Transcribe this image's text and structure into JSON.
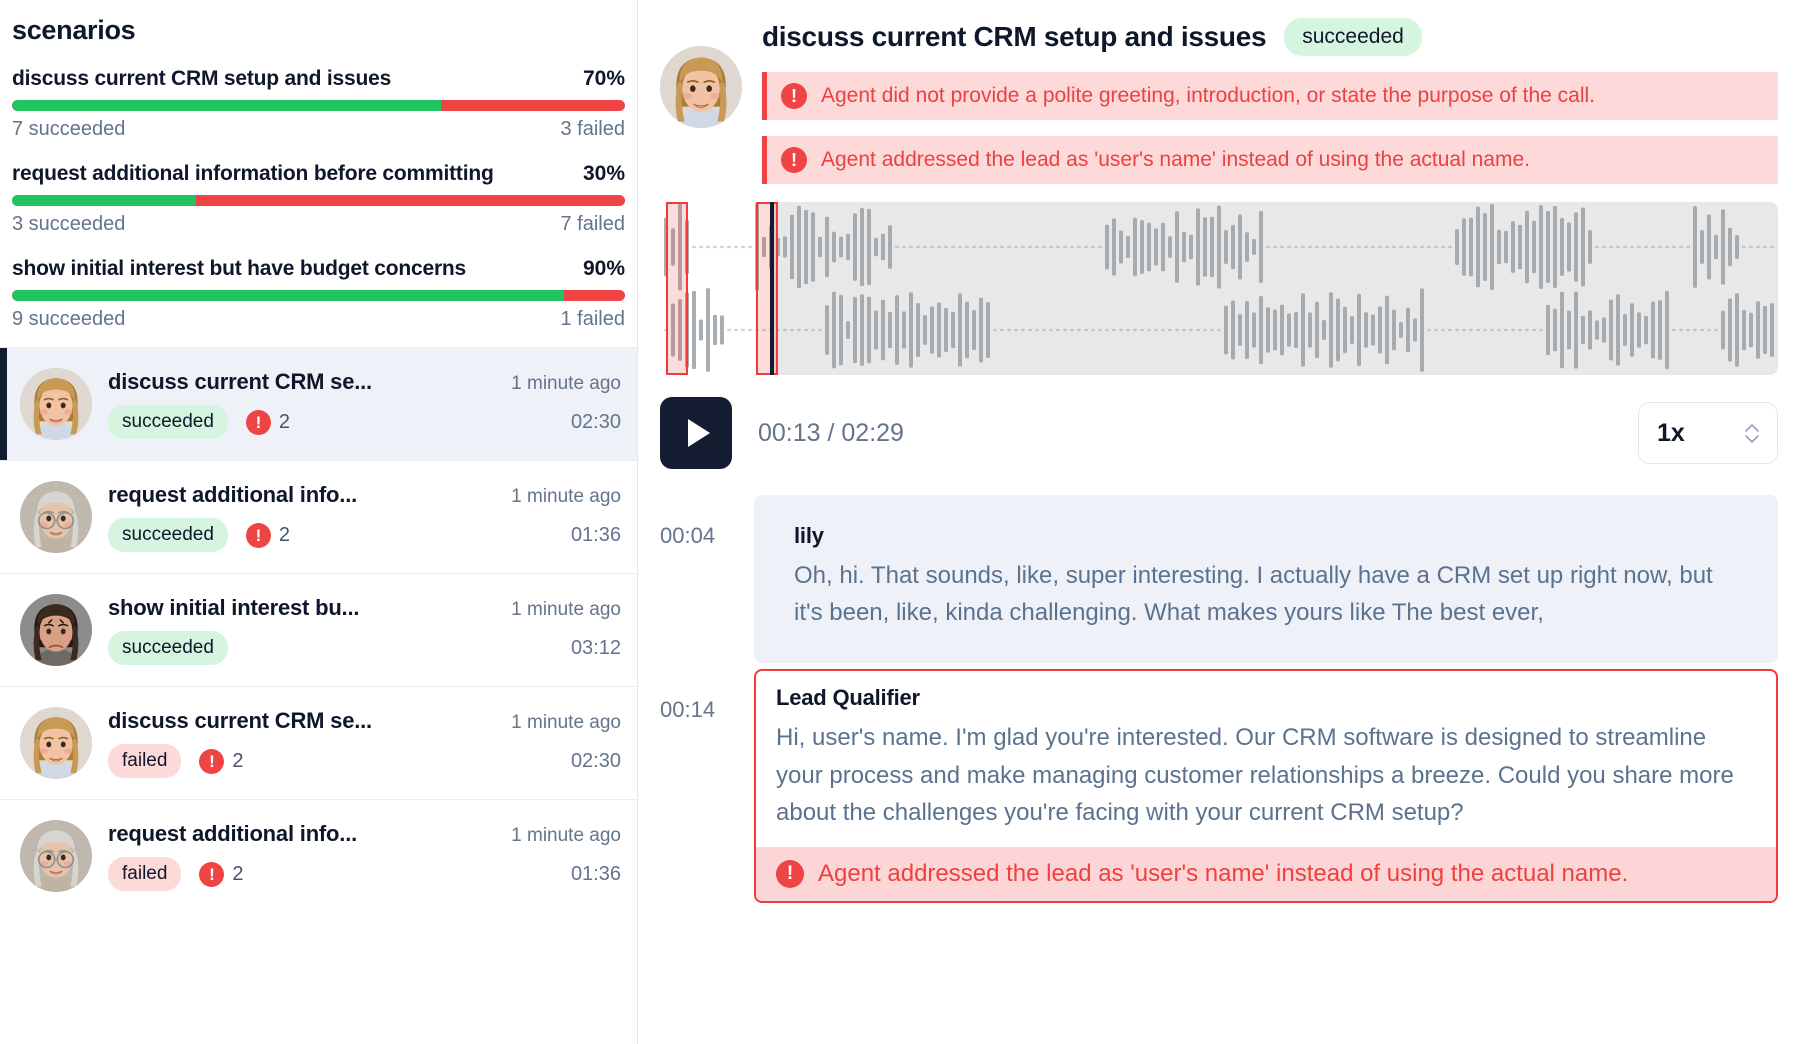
{
  "sidebar": {
    "title": "scenarios",
    "scenarios": [
      {
        "name": "discuss current CRM setup and issues",
        "percent": "70%",
        "fill": 70,
        "succeeded": "7 succeeded",
        "failed": "3 failed"
      },
      {
        "name": "request additional information before committing",
        "percent": "30%",
        "fill": 30,
        "succeeded": "3 succeeded",
        "failed": "7 failed"
      },
      {
        "name": "show initial interest but have budget concerns",
        "percent": "90%",
        "fill": 90,
        "succeeded": "9 succeeded",
        "failed": "1 failed"
      }
    ],
    "runs": [
      {
        "name": "discuss current CRM se...",
        "time": "1 minute ago",
        "status": "succeeded",
        "issues": "2",
        "duration": "02:30",
        "avatar": "woman-blonde",
        "selected": true
      },
      {
        "name": "request additional info...",
        "time": "1 minute ago",
        "status": "succeeded",
        "issues": "2",
        "duration": "01:36",
        "avatar": "woman-elder",
        "selected": false
      },
      {
        "name": "show initial interest bu...",
        "time": "1 minute ago",
        "status": "succeeded",
        "issues": "",
        "duration": "03:12",
        "avatar": "man-dark",
        "selected": false
      },
      {
        "name": "discuss current CRM se...",
        "time": "1 minute ago",
        "status": "failed",
        "issues": "2",
        "duration": "02:30",
        "avatar": "woman-blonde",
        "selected": false
      },
      {
        "name": "request additional info...",
        "time": "1 minute ago",
        "status": "failed",
        "issues": "2",
        "duration": "01:36",
        "avatar": "woman-elder",
        "selected": false
      }
    ]
  },
  "detail": {
    "avatar": "woman-blonde",
    "title": "discuss current CRM setup and issues",
    "status_badge": "succeeded",
    "alerts": [
      "Agent did not provide a polite greeting, introduction, or state the purpose of the call.",
      "Agent addressed the lead as 'user's name' instead of using the actual name."
    ],
    "player": {
      "play_label": "play",
      "current_time": "00:13",
      "time_display": "00:13 / 02:29",
      "total_time": "02:29",
      "speed": "1x",
      "progress_percent": 13
    },
    "transcript": [
      {
        "time": "00:04",
        "speaker": "lily",
        "text": "Oh, hi. That sounds, like, super interesting. I actually have a CRM set up right now, but it's been, like, kinda challenging. What makes yours like The best ever,",
        "role": "lead",
        "alert": ""
      },
      {
        "time": "00:14",
        "speaker": "Lead Qualifier",
        "text": "Hi, user's name. I'm glad you're interested. Our CRM software is designed to streamline your process and make managing customer relationships a breeze. Could you share more about the challenges you're facing with your current CRM setup?",
        "role": "agent",
        "alert": "Agent addressed the lead as 'user's name' instead of using the actual name."
      }
    ]
  },
  "colors": {
    "success": "#22c461",
    "danger": "#f04444",
    "accent_dark": "#131c31",
    "badge_success_bg": "#d6f5e0",
    "badge_fail_bg": "#fcdada"
  },
  "icons": {
    "error": "!",
    "play": "play-icon",
    "chevron_up": "⌃",
    "chevron_down": "⌄"
  }
}
